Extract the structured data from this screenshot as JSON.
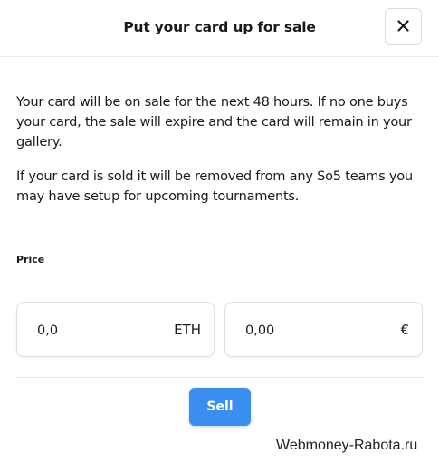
{
  "dialog": {
    "title": "Put your card up for sale",
    "close_icon": "close-icon"
  },
  "description": {
    "paragraph1": "Your card will be on sale for the next 48 hours. If no one buys your card, the sale will expire and the card will remain in your gallery.",
    "paragraph2": "If your card is sold it will be removed from any So5 teams you may have setup for upcoming tournaments."
  },
  "price": {
    "label": "Price",
    "eth_value": "0,0",
    "eth_unit": "ETH",
    "eur_value": "0,00",
    "eur_unit": "€"
  },
  "actions": {
    "sell_label": "Sell"
  },
  "watermark": "Webmoney-Rabota.ru",
  "colors": {
    "sell_button": "#3a8ef0",
    "border": "#e0e0e0"
  }
}
